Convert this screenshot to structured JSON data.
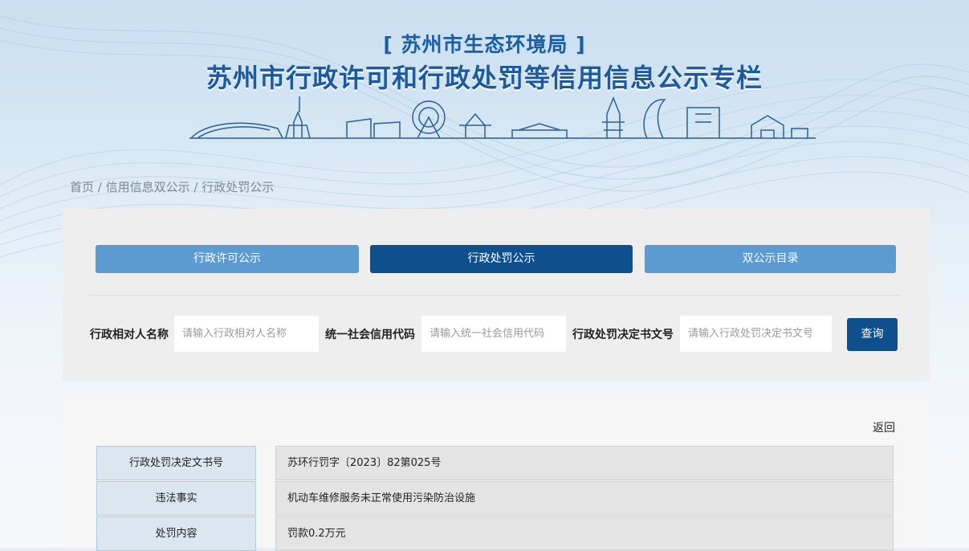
{
  "header": {
    "subtitle": "[ 苏州市生态环境局 ]",
    "title": "苏州市行政许可和行政处罚等信用信息公示专栏"
  },
  "breadcrumb": {
    "home": "首页",
    "sep": " / ",
    "level2": "信用信息双公示",
    "current": "行政处罚公示"
  },
  "tabs": [
    {
      "label": "行政许可公示"
    },
    {
      "label": "行政处罚公示"
    },
    {
      "label": "双公示目录"
    }
  ],
  "search": {
    "name_label": "行政相对人名称",
    "name_placeholder": "请输入行政相对人名称",
    "code_label": "统一社会信用代码",
    "code_placeholder": "请输入统一社会信用代码",
    "doc_label": "行政处罚决定书文号",
    "doc_placeholder": "请输入行政处罚决定书文号",
    "button": "查询"
  },
  "detail": {
    "back": "返回",
    "rows": [
      {
        "key": "行政处罚决定文书号",
        "value": "苏环行罚字〔2023〕82第025号"
      },
      {
        "key": "违法事实",
        "value": "机动车维修服务未正常使用污染防治设施"
      },
      {
        "key": "处罚内容",
        "value": "罚款0.2万元"
      }
    ]
  },
  "colors": {
    "primary_dark": "#0e4f8e",
    "primary_light": "#5b9bd1",
    "title_blue": "#1b5a9e"
  }
}
